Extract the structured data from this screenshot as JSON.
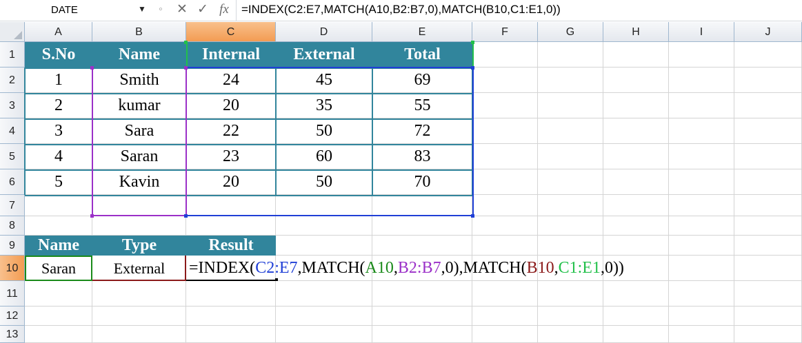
{
  "name_box": {
    "value": "DATE"
  },
  "formula_bar": {
    "formula": "=INDEX(C2:E7,MATCH(A10,B2:B7,0),MATCH(B10,C1:E1,0))"
  },
  "icons": {
    "cancel": "x-icon",
    "enter": "check-icon",
    "insert_function": "fx-icon"
  },
  "columns": [
    "A",
    "B",
    "C",
    "D",
    "E",
    "F",
    "G",
    "H",
    "I",
    "J"
  ],
  "rows": [
    "1",
    "2",
    "3",
    "4",
    "5",
    "6",
    "7",
    "8",
    "9",
    "10",
    "11",
    "12",
    "13"
  ],
  "table1": {
    "headers": [
      "S.No",
      "Name",
      "Internal",
      "External",
      "Total"
    ],
    "rows": [
      [
        "1",
        "Smith",
        "24",
        "45",
        "69"
      ],
      [
        "2",
        "kumar",
        "20",
        "35",
        "55"
      ],
      [
        "3",
        "Sara",
        "22",
        "50",
        "72"
      ],
      [
        "4",
        "Saran",
        "23",
        "60",
        "83"
      ],
      [
        "5",
        "Kavin",
        "20",
        "50",
        "70"
      ]
    ]
  },
  "table2": {
    "headers": [
      "Name",
      "Type",
      "Result"
    ],
    "values": [
      "Saran",
      "External"
    ]
  },
  "formula_cell": {
    "parts": [
      {
        "text": "=INDEX(",
        "color": "#000000"
      },
      {
        "text": "C2:E7",
        "color": "#1f3fd6"
      },
      {
        "text": ",MATCH(",
        "color": "#000000"
      },
      {
        "text": "A10",
        "color": "#1a8a1a"
      },
      {
        "text": ",",
        "color": "#000000"
      },
      {
        "text": "B2:B7",
        "color": "#9b30c8"
      },
      {
        "text": ",0),MATCH(",
        "color": "#000000"
      },
      {
        "text": "B10",
        "color": "#8b1a1a"
      },
      {
        "text": ",",
        "color": "#000000"
      },
      {
        "text": "C1:E1",
        "color": "#22c04a"
      },
      {
        "text": ",0))",
        "color": "#000000"
      }
    ]
  },
  "colors": {
    "header_fill": "#31859c",
    "selected_header": "#f39c53",
    "grid": "#d4d4d4"
  }
}
